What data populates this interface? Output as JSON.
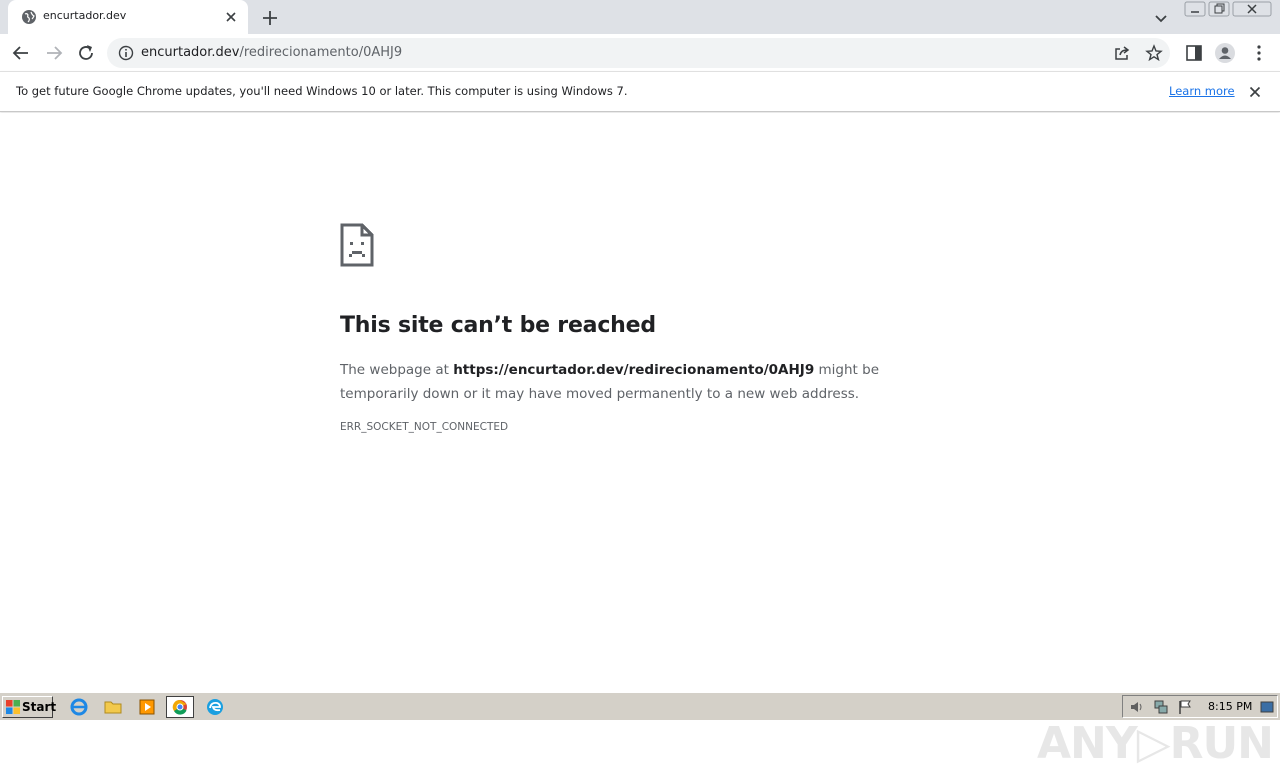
{
  "browser": {
    "tab": {
      "title": "encurtador.dev"
    },
    "url": {
      "host": "encurtador.dev",
      "path": "/redirecionamento/0AHJ9"
    }
  },
  "infobar": {
    "message": "To get future Google Chrome updates, you'll need Windows 10 or later. This computer is using Windows 7.",
    "link": "Learn more"
  },
  "error": {
    "heading": "This site can’t be reached",
    "line_prefix": "The webpage at ",
    "url": "https://encurtador.dev/redirecionamento/0AHJ9",
    "line_suffix": " might be temporarily down or it may have moved permanently to a new web address.",
    "code": "ERR_SOCKET_NOT_CONNECTED"
  },
  "watermark": "ANY▷RUN",
  "taskbar": {
    "start_label": "Start",
    "clock": "8:15 PM"
  },
  "icons": {
    "favicon": "globe-icon",
    "tab_close": "close-icon",
    "new_tab": "plus-icon",
    "back": "back-arrow-icon",
    "forward": "forward-arrow-icon",
    "reload": "reload-icon",
    "site_info": "info-icon",
    "share": "share-icon",
    "bookmark": "star-icon",
    "side_panel": "side-panel-icon",
    "profile": "profile-icon",
    "menu": "kebab-menu-icon",
    "error": "sad-page-icon"
  },
  "colors": {
    "tabstrip": "#dee1e6",
    "omnibox": "#f1f3f4",
    "link": "#1a73e8",
    "heading": "#202124",
    "body": "#5f6368",
    "taskbar": "#d4d0c8"
  }
}
